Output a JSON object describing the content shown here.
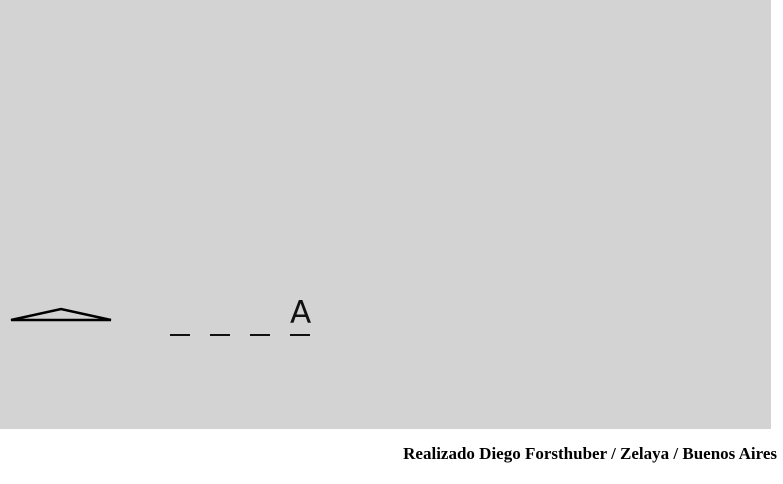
{
  "game": {
    "background_color": "#d3d3d3",
    "player": {
      "icon": "ship-triangle-icon"
    },
    "word": {
      "slots": [
        "",
        "",
        "",
        "A"
      ]
    }
  },
  "footer": {
    "credit": "Realizado Diego Forsthuber / Zelaya / Buenos Aires"
  }
}
